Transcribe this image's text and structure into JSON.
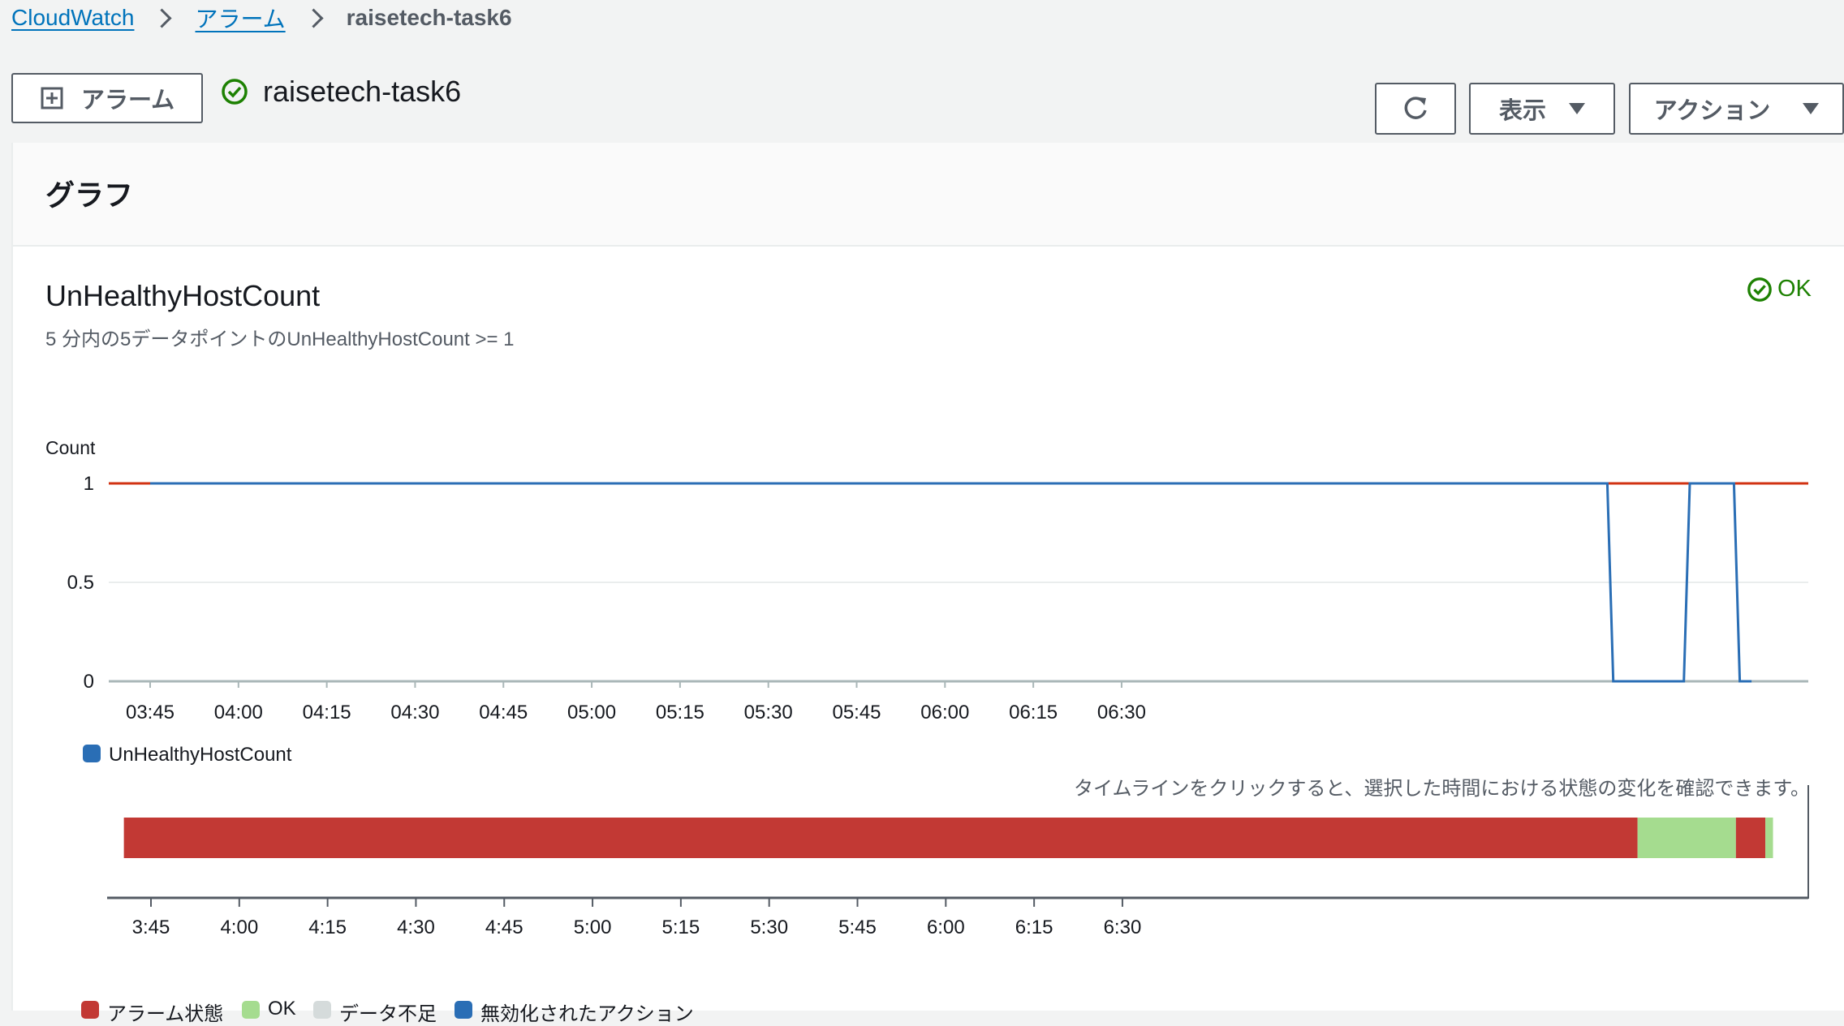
{
  "breadcrumb": {
    "root": "CloudWatch",
    "alarms": "アラーム",
    "current": "raisetech-task6"
  },
  "header": {
    "create_alarm": "アラーム",
    "alarm_name": "raisetech-task6",
    "refresh_icon": "refresh-icon",
    "view_label": "表示",
    "actions_label": "アクション"
  },
  "panel": {
    "title": "グラフ"
  },
  "alarm": {
    "metric_name": "UnHealthyHostCount",
    "condition": "5 分内の5データポイントのUnHealthyHostCount >= 1",
    "state": "OK",
    "timeline_hint": "タイムラインをクリックすると、選択した時間における状態の変化を確認できます。"
  },
  "colors": {
    "alarm": "#c23934",
    "ok": "#a5dc8f",
    "insufficient": "#d5dbdb",
    "disabled_action": "#2a6eb5",
    "series": "#2a6eb5",
    "threshold": "#d13212",
    "state_ok_text": "#1d8102"
  },
  "chart_data": {
    "type": "line",
    "ylabel": "Count",
    "yticks": [
      "1",
      "0.5",
      "0"
    ],
    "ylim": [
      0,
      1
    ],
    "xticks": [
      "03:45",
      "04:00",
      "04:15",
      "04:30",
      "04:45",
      "05:00",
      "05:15",
      "05:30",
      "05:45",
      "06:00",
      "06:15",
      "06:30"
    ],
    "threshold": 1,
    "series": [
      {
        "name": "UnHealthyHostCount",
        "points": [
          [
            0,
            1
          ],
          [
            247,
            1
          ],
          [
            247.5,
            1
          ],
          [
            248.5,
            0
          ],
          [
            260.5,
            0
          ],
          [
            261.5,
            1
          ],
          [
            269,
            1
          ],
          [
            270,
            0
          ],
          [
            272,
            0
          ]
        ]
      }
    ],
    "x_unit_note": "minutes after 03:45"
  },
  "timeline": {
    "xticks": [
      "3:45",
      "4:00",
      "4:15",
      "4:30",
      "4:45",
      "5:00",
      "5:15",
      "5:30",
      "5:45",
      "6:00",
      "6:15",
      "6:30"
    ],
    "segments": [
      {
        "state": "alarm",
        "start": -4.6,
        "end": 252.5
      },
      {
        "state": "ok",
        "start": 252.5,
        "end": 269.2
      },
      {
        "state": "alarm",
        "start": 269.2,
        "end": 274.2
      },
      {
        "state": "ok",
        "start": 274.2,
        "end": 275.5
      }
    ],
    "legend": [
      "アラーム状態",
      "OK",
      "データ不足",
      "無効化されたアクション"
    ]
  }
}
